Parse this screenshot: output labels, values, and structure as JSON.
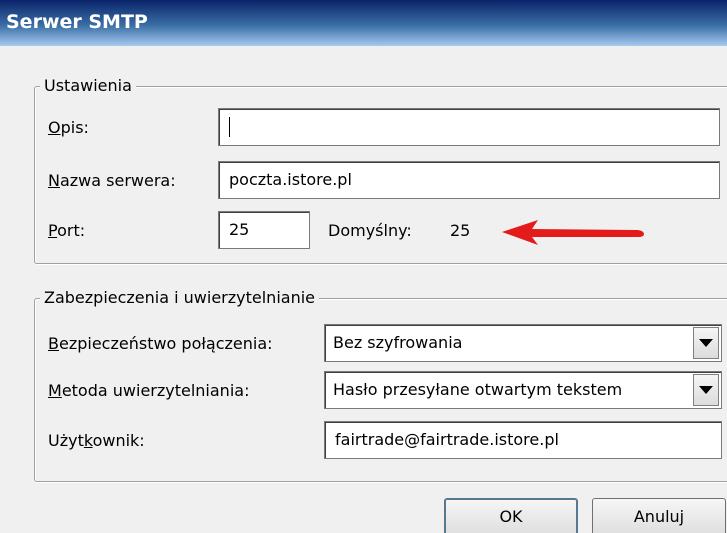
{
  "window": {
    "title": "Serwer SMTP"
  },
  "settings_group": {
    "legend": "Ustawienia",
    "description": {
      "label_first": "O",
      "label_rest": "pis:",
      "value": ""
    },
    "server_name": {
      "label_first": "N",
      "label_rest": "azwa serwera:",
      "value": "poczta.istore.pl"
    },
    "port": {
      "label_first": "P",
      "label_rest": "ort:",
      "value": "25",
      "default_label": "Domyślny:",
      "default_value": "25"
    }
  },
  "security_group": {
    "legend": "Zabezpieczenia i uwierzytelnianie",
    "connection_security": {
      "label_first": "B",
      "label_rest": "ezpieczeństwo połączenia:",
      "selected": "Bez szyfrowania"
    },
    "auth_method": {
      "label_first": "M",
      "label_rest": "etoda uwierzytelniania:",
      "selected": "Hasło przesyłane otwartym tekstem"
    },
    "user": {
      "label_before": "Użyt",
      "label_underlined": "k",
      "label_after": "ownik:",
      "value": "fairtrade@fairtrade.istore.pl"
    }
  },
  "buttons": {
    "ok": "OK",
    "cancel": "Anuluj"
  },
  "annotation": {
    "arrow_color": "#e31b1b"
  },
  "icons": {
    "dropdown": "chevron-down-icon",
    "arrow": "red-arrow-icon"
  }
}
